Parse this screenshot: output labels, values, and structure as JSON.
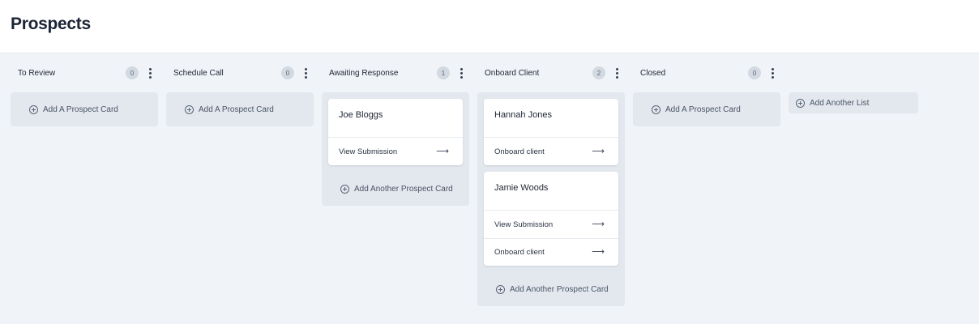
{
  "page": {
    "title": "Prospects"
  },
  "columns": [
    {
      "title": "To Review",
      "count": "0",
      "add_label": "Add A Prospect Card"
    },
    {
      "title": "Schedule Call",
      "count": "0",
      "add_label": "Add A Prospect Card"
    },
    {
      "title": "Awaiting Response",
      "count": "1",
      "cards": [
        {
          "name": "Joe Bloggs",
          "actions": [
            "View Submission"
          ]
        }
      ],
      "add_label": "Add Another Prospect Card"
    },
    {
      "title": "Onboard Client",
      "count": "2",
      "cards": [
        {
          "name": "Hannah Jones",
          "actions": [
            "Onboard client"
          ]
        },
        {
          "name": "Jamie Woods",
          "actions": [
            "View Submission",
            "Onboard client"
          ]
        }
      ],
      "add_label": "Add Another Prospect Card"
    },
    {
      "title": "Closed",
      "count": "0",
      "add_label": "Add A Prospect Card"
    }
  ],
  "add_list_label": "Add Another List",
  "icons": {
    "add": "plus-circle-icon",
    "arrow": "arrow-right-icon",
    "menu": "more-vertical-icon"
  },
  "colors": {
    "board_bg": "#f0f3f7",
    "column_bg": "#e3e8ee",
    "card_bg": "#ffffff",
    "badge_bg": "#d3d9e1"
  }
}
